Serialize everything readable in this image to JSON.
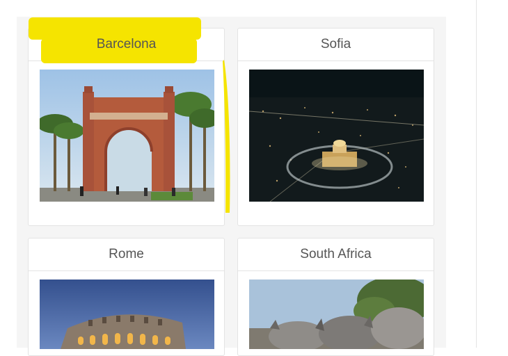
{
  "cards": [
    {
      "title": "Barcelona",
      "image": "arc-de-triomf-photo",
      "highlighted": true
    },
    {
      "title": "Sofia",
      "image": "night-aerial-city-photo",
      "highlighted": false
    },
    {
      "title": "Rome",
      "image": "colosseum-photo",
      "highlighted": false
    },
    {
      "title": "South Africa",
      "image": "rhinos-photo",
      "highlighted": false
    }
  ],
  "colors": {
    "highlight": "#f5e400",
    "border": "#e3e3e3",
    "panel": "#f5f5f5",
    "text": "#555555"
  }
}
